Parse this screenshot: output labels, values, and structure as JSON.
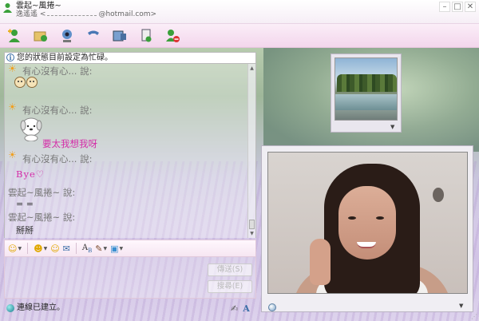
{
  "window": {
    "title": "雲起~風捲~",
    "subtitle_name": "逸遙遙",
    "subtitle_email": "@hotmail.com"
  },
  "toolbar": {
    "buttons": [
      {
        "name": "invite-icon",
        "glyph": "👤"
      },
      {
        "name": "send-files-icon",
        "glyph": "📁"
      },
      {
        "name": "video-icon",
        "glyph": "🎥"
      },
      {
        "name": "voice-call-icon",
        "glyph": "📞"
      },
      {
        "name": "activities-icon",
        "glyph": "🎞"
      },
      {
        "name": "games-icon",
        "glyph": "🎲"
      },
      {
        "name": "block-icon",
        "glyph": "🚫"
      }
    ]
  },
  "chat": {
    "header": "您的狀態目前設定為忙碌。",
    "messages": [
      {
        "sender": "有心沒有心... 說:"
      },
      {
        "sender": "有心沒有心... 說:",
        "text": "要太我想我呀"
      },
      {
        "sender": "有心沒有心... 說:",
        "text": "Bye♡"
      },
      {
        "sender": "雲起~風捲~ 說:",
        "text": "= ="
      },
      {
        "sender": "雲起~風捲~ 說:",
        "text": "掰掰"
      }
    ]
  },
  "format_toolbar": {
    "font_label": "A",
    "font_sub": "B"
  },
  "input": {
    "send_label": "傳送(S)",
    "search_label": "搜尋(E)"
  },
  "status": {
    "connection": "連線已建立。"
  },
  "colors": {
    "accent_pink": "#d42ca8",
    "toolbar_pink": "#f3d6ec"
  }
}
